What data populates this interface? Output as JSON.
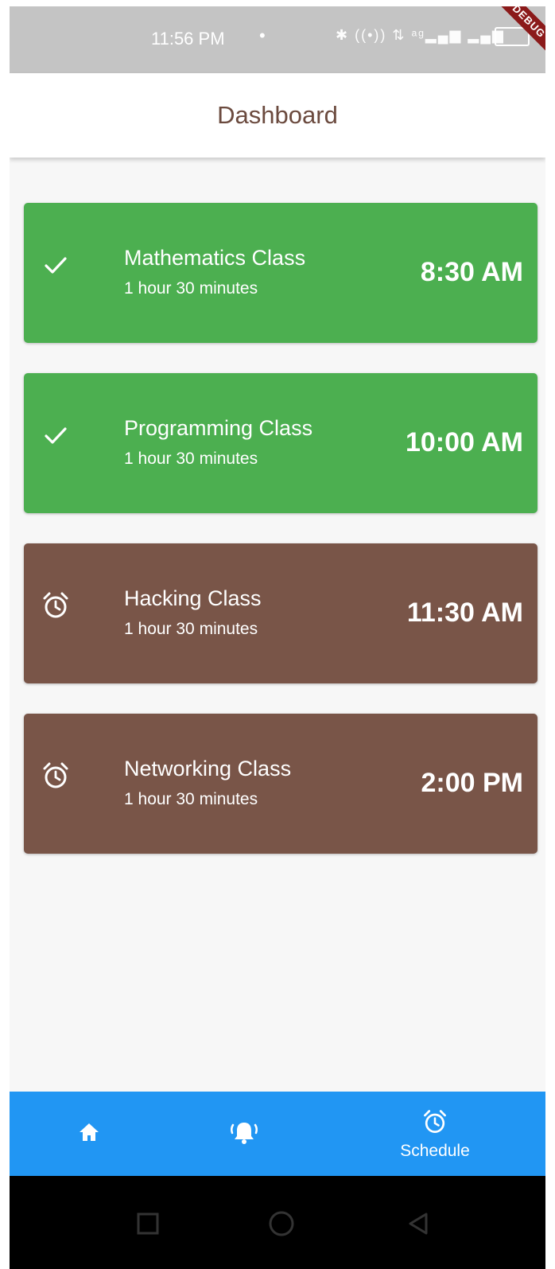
{
  "status_bar": {
    "time": "11:56 PM",
    "dot": "•",
    "icons_text": "✱ ((•)) ⇅ ᵃᵍ▂▄▆ ▂▄▆",
    "debug_label": "DEBUG"
  },
  "app_bar": {
    "title": "Dashboard"
  },
  "classes": [
    {
      "title": "Mathematics Class",
      "duration": "1 hour 30 minutes",
      "time": "8:30 AM",
      "status": "done",
      "icon": "check-icon",
      "color": "#4caf50"
    },
    {
      "title": "Programming Class",
      "duration": "1 hour 30 minutes",
      "time": "10:00 AM",
      "status": "done",
      "icon": "check-icon",
      "color": "#4caf50"
    },
    {
      "title": "Hacking Class",
      "duration": "1 hour 30 minutes",
      "time": "11:30 AM",
      "status": "pending",
      "icon": "alarm-icon",
      "color": "#795548"
    },
    {
      "title": "Networking Class",
      "duration": "1 hour 30 minutes",
      "time": "2:00 PM",
      "status": "pending",
      "icon": "alarm-icon",
      "color": "#795548"
    }
  ],
  "bottom_nav": {
    "items": [
      {
        "icon": "home-icon",
        "label": ""
      },
      {
        "icon": "bell-ringing-icon",
        "label": ""
      },
      {
        "icon": "alarm-icon",
        "label": "Schedule"
      }
    ],
    "color": "#2196f3"
  }
}
